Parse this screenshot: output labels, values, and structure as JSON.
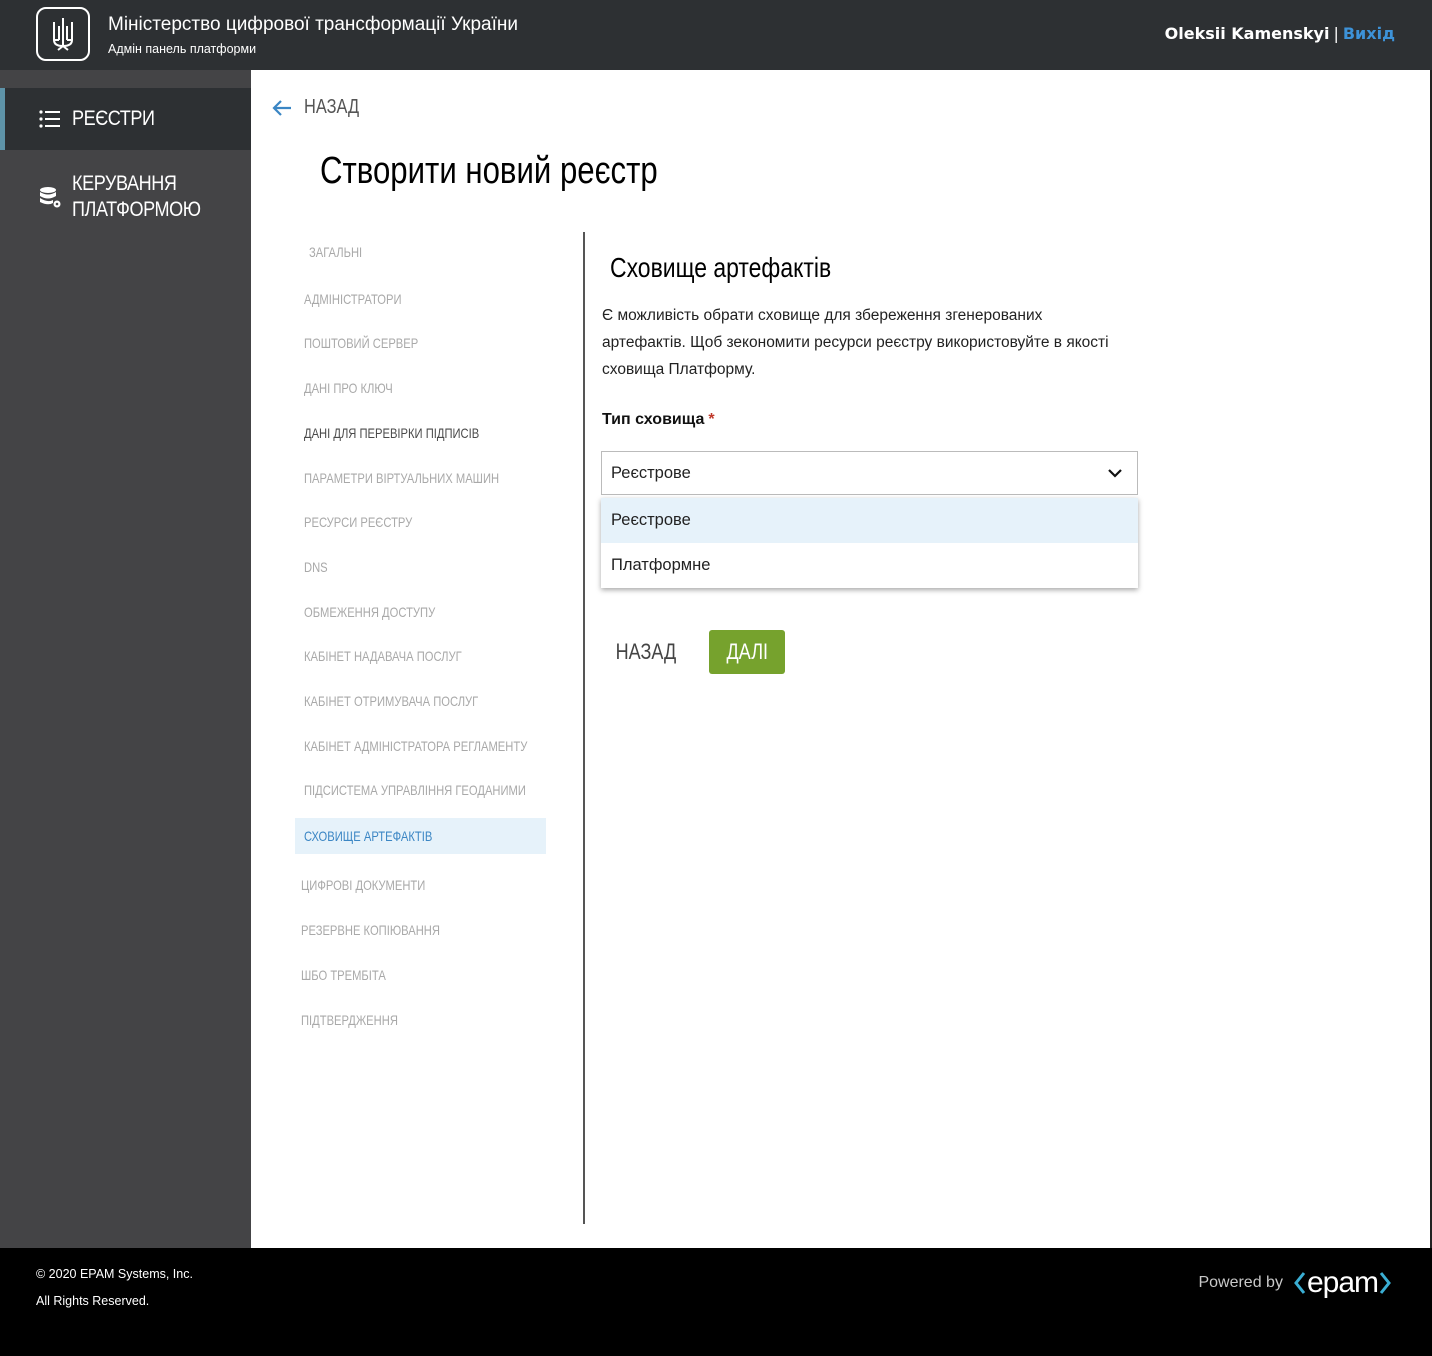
{
  "header": {
    "org_title": "Міністерство цифрової трансформації України",
    "org_subtitle": "Адмін панель платформи",
    "user_name": "Oleksii Kamenskyi",
    "separator": "|",
    "logout": "Вихід"
  },
  "sidebar": {
    "items": [
      {
        "label": "РЕЄСТРИ",
        "icon": "list-icon",
        "active": true
      },
      {
        "label_line1": "КЕРУВАННЯ",
        "label_line2": "ПЛАТФОРМОЮ",
        "icon": "database-gear-icon"
      }
    ]
  },
  "main": {
    "back_link": "НАЗАД",
    "page_title": "Створити новий реєстр",
    "steps": [
      {
        "label": "ЗАГАЛЬНІ"
      },
      {
        "label": "АДМІНІСТРАТОРИ"
      },
      {
        "label": "ПОШТОВИЙ СЕРВЕР"
      },
      {
        "label": "ДАНІ ПРО КЛЮЧ"
      },
      {
        "label": "ДАНІ ДЛЯ ПЕРЕВІРКИ ПІДПИСІВ"
      },
      {
        "label": "ПАРАМЕТРИ ВІРТУАЛЬНИХ МАШИН"
      },
      {
        "label": "РЕСУРСИ РЕЄСТРУ"
      },
      {
        "label": "DNS"
      },
      {
        "label": "ОБМЕЖЕННЯ ДОСТУПУ"
      },
      {
        "label": "КАБІНЕТ НАДАВАЧА ПОСЛУГ"
      },
      {
        "label": "КАБІНЕТ ОТРИМУВАЧА ПОСЛУГ"
      },
      {
        "label": "КАБІНЕТ АДМІНІСТРАТОРА РЕГЛАМЕНТУ"
      },
      {
        "label": "ПІДСИСТЕМА УПРАВЛІННЯ ГЕОДАНИМИ"
      },
      {
        "label": "СХОВИЩЕ АРТЕФАКТІВ"
      },
      {
        "label": "ЦИФРОВІ ДОКУМЕНТИ"
      },
      {
        "label": "РЕЗЕРВНЕ КОПІЮВАННЯ"
      },
      {
        "label": "ШБО ТРЕМБІТА"
      },
      {
        "label": "ПІДТВЕРДЖЕННЯ"
      }
    ],
    "section_title": "Сховище артефактів",
    "description": "Є можливість обрати сховище для збереження згенерованих артефактів. Щоб зекономити ресурси реєстру використовуйте в якості сховища Платформу.",
    "field_label": "Тип сховища",
    "required_mark": "*",
    "select_value": "Реєстрове",
    "options": [
      "Реєстрове",
      "Платформне"
    ],
    "btn_back": "НАЗАД",
    "btn_next": "ДАЛІ"
  },
  "footer": {
    "copyright": "© 2020 EPAM Systems, Inc.",
    "rights": "All Rights Reserved.",
    "powered_by": "Powered by",
    "brand": "epam"
  },
  "colors": {
    "header_bg": "#2d3033",
    "sidebar_bg": "#444446",
    "accent_blue": "#3b86c4",
    "next_green": "#76a22d"
  }
}
